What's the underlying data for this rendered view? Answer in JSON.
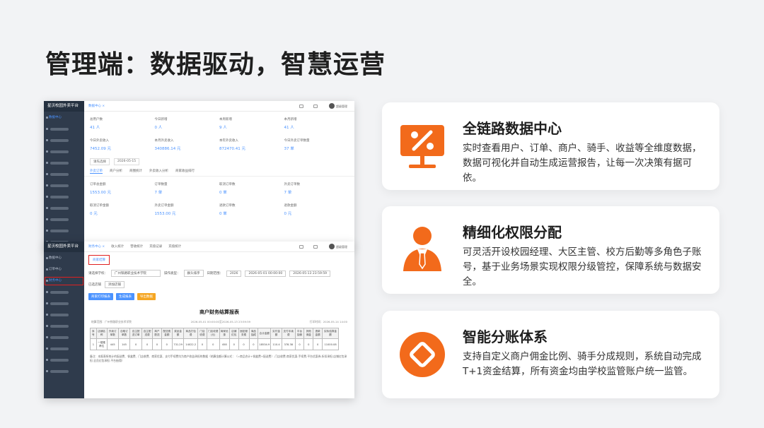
{
  "title": "管理端：数据驱动，智慧运营",
  "accent_color": "#f26a1b",
  "screenshot1": {
    "app_name": "星沃校园外卖平台",
    "breadcrumb": "数据中心 ×",
    "user": "超级管理",
    "menu": [
      "数据中心",
      "",
      "",
      "",
      "",
      "",
      "",
      "",
      "",
      "",
      "",
      ""
    ],
    "stats": [
      {
        "label": "总用户数",
        "value": "41 人"
      },
      {
        "label": "今日新增",
        "value": "0 人"
      },
      {
        "label": "本周新增",
        "value": "9 人"
      },
      {
        "label": "本月新增",
        "value": "41 人"
      },
      {
        "label": "今日外卖收入",
        "value": "7452.09 元"
      },
      {
        "label": "本月外卖收入",
        "value": "340886.14 元"
      },
      {
        "label": "本年外卖收入",
        "value": "872470.41 元"
      },
      {
        "label": "今日外卖订单数量",
        "value": "37 单"
      }
    ],
    "filters": [
      "请先选择",
      "2026-05-15"
    ],
    "tabs": [
      "外卖订单",
      "商户分析",
      "商圈统计",
      "外卖收入分析",
      "商家收益排行",
      "",
      ""
    ],
    "stats2": [
      {
        "label": "订单总金额",
        "value": "1553.00 元"
      },
      {
        "label": "订单数量",
        "value": "7 单"
      },
      {
        "label": "取消订单数",
        "value": "0 单"
      },
      {
        "label": "外卖订单数",
        "value": "7 单"
      },
      {
        "label": "取消订单金额",
        "value": "0 元"
      },
      {
        "label": "外卖订单金额",
        "value": "1553.00 元"
      },
      {
        "label": "退款订单数",
        "value": "0 单"
      },
      {
        "label": "退款金额",
        "value": "0 元"
      }
    ]
  },
  "screenshot2": {
    "app_name": "星沃校园外卖平台",
    "menu": [
      "数据中心",
      "订单中心",
      "财务中心",
      "",
      "",
      "",
      "",
      "",
      "",
      "",
      "",
      ""
    ],
    "tabs": [
      "财务中心 ×",
      "收入统计",
      "营收统计",
      "充值记录",
      "充值统计"
    ],
    "user": "超级管理",
    "sub_tab": "商家结算",
    "filter_labels": {
      "school": "请选择学校：",
      "type": "操作类型：",
      "date": "日期范围："
    },
    "school_value": "广州铁路职业技术学院",
    "type_value": "群头排序",
    "date_values": [
      "2026",
      "2026-05-01 00:00:00",
      "2026-05-13 23:59:59"
    ],
    "checkbox_label": "已选店铺",
    "add_shop": "添加店铺",
    "buttons": [
      "商家打印报表",
      "生成报表",
      "导出数据"
    ],
    "button_colors": [
      "#4b93ff",
      "#4b93ff",
      "#f5a623"
    ],
    "report_title": "商户财务结算报表",
    "meta": [
      "结算范围：广州铁路职业技术学院",
      "2026-05-01 00:00:00至2026-05-13 23:59:59",
      "打印时间：2026-05-14 14:00"
    ],
    "table_headers": [
      "序号",
      "店铺名称",
      "外卖订单数",
      "自取订单数",
      "自主配送订单",
      "自主配送费",
      "商户配送",
      "配送费金额",
      "菜品金额",
      "商品打包费",
      "门店收费",
      "门店收费(元)",
      "商家优惠",
      "店铺红包",
      "固定服务费",
      "商品抽成",
      "合计金额",
      "实付金额",
      "支付手续费",
      "平台抽佣",
      "其他佣金",
      "退款金额",
      "实际结算金额"
    ],
    "table_row": [
      "1",
      "一楼推荐位",
      "445",
      "145",
      "0",
      "0",
      "0",
      "0",
      "731.29",
      "14022.2",
      "0",
      "0",
      "458",
      "0",
      "0",
      "0",
      "18534.9",
      "110.4",
      "378.38",
      "0",
      "0",
      "0",
      "11000.08"
    ],
    "note": "备注：本报表所统计的配送费、餐盒费、门店收费、商家优惠、支付手续费均为商户收益承担的数据（结算金额计算公式：（=商品合计+餐盒费+配送费）-门店收费-商家优惠-手续费-平台优惠券-折扣承担-店铺红包承担-全员红包承担-平台抽佣）"
  },
  "features": [
    {
      "title": "全链路数据中心",
      "desc": "实时查看用户、订单、商户、骑手、收益等全维度数据，数据可视化并自动生成运营报告，让每一次决策有据可依。",
      "icon": "chart-percent-icon"
    },
    {
      "title": "精细化权限分配",
      "desc": "可灵活开设校园经理、大区主管、校方后勤等多角色子账号，基于业务场景实现权限分级管控，保障系统与数据安全。",
      "icon": "manager-person-icon"
    },
    {
      "title": "智能分账体系",
      "desc": "支持自定义商户佣金比例、骑手分成规则，系统自动完成T+1资金结算，所有资金均由学校监管账户统一监管。",
      "icon": "split-account-icon"
    }
  ]
}
